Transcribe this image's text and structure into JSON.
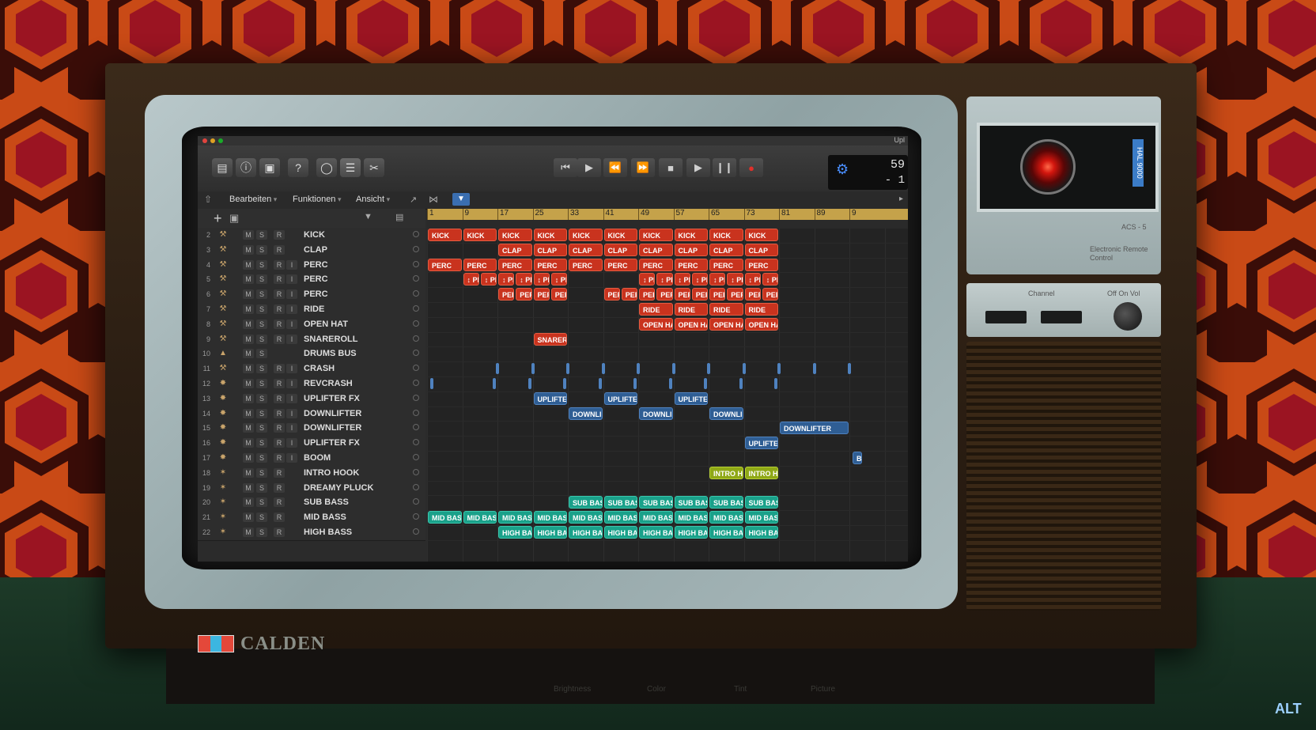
{
  "window": {
    "title": "Upl"
  },
  "menus": [
    "Bearbeiten",
    "Funktionen",
    "Ansicht"
  ],
  "transport": {
    "time": "59",
    "bar": "- 1"
  },
  "ruler": {
    "bars": [
      "1",
      "9",
      "17",
      "25",
      "33",
      "41",
      "49",
      "57",
      "65",
      "73",
      "81",
      "89",
      "9"
    ]
  },
  "buttons": {
    "M": "M",
    "S": "S",
    "R": "R",
    "I": "I"
  },
  "tracks": [
    {
      "num": "2",
      "name": "KICK",
      "icon": "drum-icon"
    },
    {
      "num": "3",
      "name": "CLAP",
      "icon": "drum-icon"
    },
    {
      "num": "4",
      "name": "PERC",
      "icon": "drum-icon"
    },
    {
      "num": "5",
      "name": "PERC",
      "icon": "drum-icon"
    },
    {
      "num": "6",
      "name": "PERC",
      "icon": "drum-icon"
    },
    {
      "num": "7",
      "name": "RIDE",
      "icon": "drum-icon"
    },
    {
      "num": "8",
      "name": "OPEN HAT",
      "icon": "drum-icon"
    },
    {
      "num": "9",
      "name": "SNAREROLL",
      "icon": "drum-icon"
    },
    {
      "num": "10",
      "name": "DRUMS BUS",
      "icon": "bus-icon"
    },
    {
      "num": "11",
      "name": "CRASH",
      "icon": "drum-icon"
    },
    {
      "num": "12",
      "name": "REVCRASH",
      "icon": "fx-icon"
    },
    {
      "num": "13",
      "name": "UPLIFTER FX",
      "icon": "fx-icon"
    },
    {
      "num": "14",
      "name": "DOWNLIFTER",
      "icon": "fx-icon"
    },
    {
      "num": "15",
      "name": "DOWNLIFTER",
      "icon": "fx-icon"
    },
    {
      "num": "16",
      "name": "UPLIFTER FX",
      "icon": "fx-icon"
    },
    {
      "num": "17",
      "name": "BOOM",
      "icon": "fx-icon"
    },
    {
      "num": "18",
      "name": "INTRO HOOK",
      "icon": "synth-icon"
    },
    {
      "num": "19",
      "name": "DREAMY PLUCK",
      "icon": "synth-icon"
    },
    {
      "num": "20",
      "name": "SUB BASS",
      "icon": "synth-icon"
    },
    {
      "num": "21",
      "name": "MID BASS",
      "icon": "synth-icon"
    },
    {
      "num": "22",
      "name": "HIGH BASS",
      "icon": "synth-icon"
    }
  ],
  "clips": {
    "kick": "KICK",
    "clap": "CLAP",
    "perc": "PERC",
    "perc_short": "↕ PI",
    "per": "PER",
    "ride": "RIDE",
    "open_hat": "OPEN HA",
    "snare": "SNARER",
    "uplifter": "UPLIFTEI",
    "downlifter": "DOWNLI",
    "downlifter_full": "DOWNLIFTER",
    "uplifter_full": "UPLIFTER",
    "boom": "B",
    "intro": "INTRO H",
    "sub": "SUB BAS",
    "mid": "MID BAS",
    "high": "HIGH BA"
  },
  "side_panel": {
    "hal": "HAL 9000",
    "acs": "ACS - 5",
    "erc": "Electronic Remote Control",
    "channel": "Channel",
    "offon": "Off On Vol"
  },
  "brand": {
    "name": "CALDEN",
    "labels": [
      "Brightness",
      "Color",
      "Tint",
      "Picture"
    ]
  },
  "corner": "ALT",
  "colors": {
    "red_clip": "#c9331e",
    "blue_clip": "#2f5e94",
    "yellow_clip": "#8fa816",
    "teal_clip": "#1aa18a",
    "ruler": "#c5a24a"
  }
}
